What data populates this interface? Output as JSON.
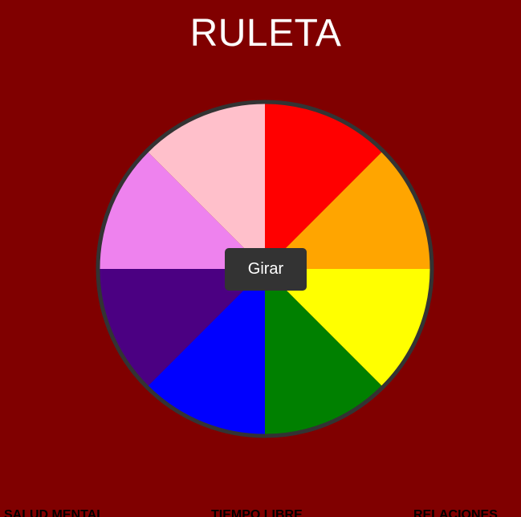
{
  "header": {
    "title": "RULETA"
  },
  "wheel": {
    "segments": [
      {
        "color": "#ff0000"
      },
      {
        "color": "#ffa500"
      },
      {
        "color": "#ffff00"
      },
      {
        "color": "#008000"
      },
      {
        "color": "#0000ff"
      },
      {
        "color": "#4b0082"
      },
      {
        "color": "#ee82ee"
      },
      {
        "color": "#ffc0cb"
      }
    ],
    "border_color": "#333333",
    "spin_label": "Girar"
  },
  "categories": {
    "items": [
      {
        "label": "SALUD MENTAL"
      },
      {
        "label": "TIEMPO LIBRE"
      },
      {
        "label": "RELACIONES"
      }
    ]
  },
  "colors": {
    "background": "#800000",
    "title": "#ffffff",
    "button_bg": "#333333",
    "button_text": "#ffffff"
  }
}
